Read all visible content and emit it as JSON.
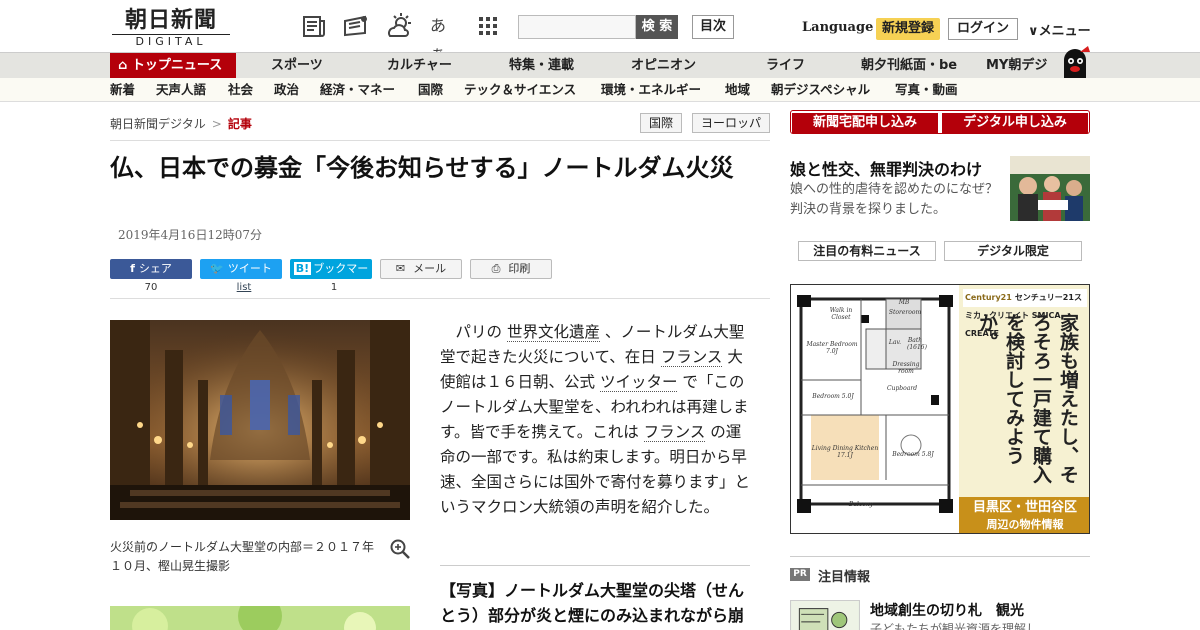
{
  "header": {
    "logo_main": "朝日新聞",
    "logo_sub": "DIGITAL",
    "icon_kana": "あぁ",
    "search_placeholder": "",
    "search_label": "検 索",
    "toc_label": "目次",
    "language_label": "Language",
    "signup_label": "新規登録",
    "login_label": "ログイン",
    "menu_label": "メニュー"
  },
  "nav_primary": {
    "top_news": "トップニュース",
    "items": [
      "スポーツ",
      "カルチャー",
      "特集・連載",
      "オピニオン",
      "ライフ",
      "朝夕刊紙面・be",
      "MY朝デジ"
    ]
  },
  "nav_secondary": {
    "items": [
      "新着",
      "天声人語",
      "社会",
      "政治",
      "経済・マネー",
      "国際",
      "テック＆サイエンス",
      "環境・エネルギー",
      "地域",
      "朝デジスペシャル",
      "写真・動画"
    ]
  },
  "breadcrumb": {
    "home": "朝日新聞デジタル",
    "separator": ">",
    "current": "記事"
  },
  "tags": [
    "国際",
    "ヨーロッパ"
  ],
  "article": {
    "headline": "仏、日本での募金「今後お知らせする」ノートルダム火災",
    "date": "2019年4月16日12時07分",
    "share": [
      {
        "label": "シェア",
        "count": "70"
      },
      {
        "label": "ツイート",
        "count": "list"
      },
      {
        "label": "ブックマーク",
        "count": "1"
      },
      {
        "label": "メール"
      },
      {
        "label": "印刷"
      }
    ],
    "caption": "火災前のノートルダム大聖堂の内部＝２０１７年１０月、樫山晃生撮影",
    "body": {
      "t1": "パリの ",
      "l1": "世界文化遺産",
      "t2": " 、ノートルダム大聖堂で起きた火災について、在日 ",
      "l2": "フランス",
      "t3": " 大使館は１６日朝、公式 ",
      "l3": "ツイッター",
      "t4": " で「このノートルダム大聖堂を、われわれは再建します。皆で手を携えて。これは ",
      "l4": "フランス",
      "t5": " の運命の一部です。私は約束します。明日から早速、全国さらには国外で寄付を募ります」というマクロン大統領の声明を紹介した。"
    },
    "related": "【写真】ノートルダム大聖堂の尖塔（せんとう）部分が炎と煙にのみ込まれながら崩れ落ちる瞬間となりました"
  },
  "sidebar": {
    "apply_home": "新聞宅配申し込み",
    "apply_digital": "デジタル申し込み",
    "promo_title": "娘と性交、無罪判決のわけ",
    "promo_desc": "娘への性的虐待を認めたのになぜ？　判決の背景を探りました。",
    "tab_paid": "注目の有料ニュース",
    "tab_digital": "デジタル限定",
    "ad": {
      "brand_logo": "Century21",
      "brand_text": "センチュリー21スミカ・クリエイト SMICA CREATE",
      "copy": "家族も増えたし、そろそろ一戸建て購入を検討してみようか。",
      "area": "目黒区・世田谷区",
      "area_sub": "周辺の物件情報",
      "rooms": [
        "Walk in Closet",
        "Storeroom",
        "Master Bedroom 7.0J",
        "Bath (1616)",
        "Lav.",
        "Dressing room",
        "Cupboard",
        "Bedroom 5.0J",
        "Living Dining Kitchen 17.1J",
        "Bedroom 5.8J",
        "Balcony",
        "MB"
      ]
    },
    "pr_badge": "PR",
    "pr_title": "注目情報",
    "pr_head": "地域創生の切り札　観光",
    "pr_sub": "子どもたちが観光資源を理解し"
  },
  "colors": {
    "brand_red": "#b4000a",
    "signup_yellow": "#f6d154",
    "facebook": "#3b5998",
    "twitter": "#1da1f2",
    "hatena": "#00a4de"
  }
}
